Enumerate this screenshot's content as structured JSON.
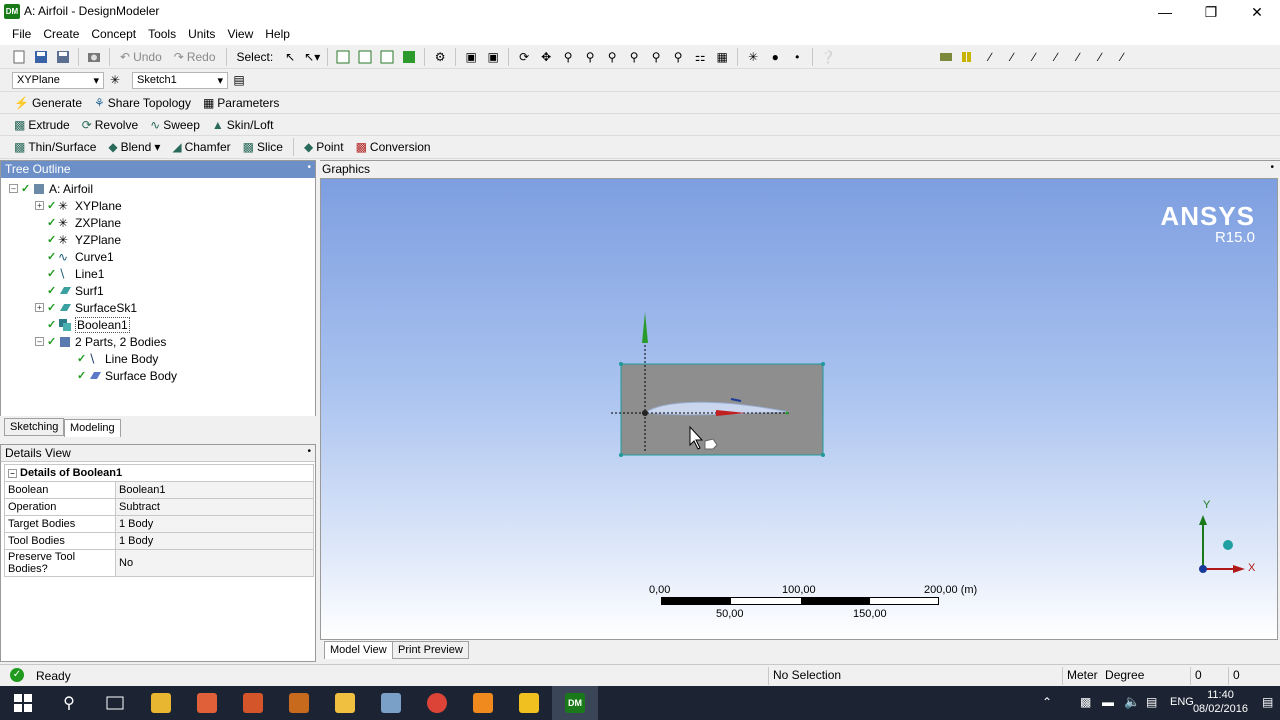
{
  "window": {
    "title": "A: Airfoil - DesignModeler",
    "app_badge": "DM"
  },
  "menu": [
    "File",
    "Create",
    "Concept",
    "Tools",
    "Units",
    "View",
    "Help"
  ],
  "toolbar1": {
    "undo": "Undo",
    "redo": "Redo",
    "select": "Select:"
  },
  "toolbar2": {
    "plane": "XYPlane",
    "sketch": "Sketch1"
  },
  "toolbar3": {
    "generate": "Generate",
    "share_topology": "Share Topology",
    "parameters": "Parameters"
  },
  "toolbar4": {
    "extrude": "Extrude",
    "revolve": "Revolve",
    "sweep": "Sweep",
    "skin_loft": "Skin/Loft"
  },
  "toolbar5": {
    "thin_surface": "Thin/Surface",
    "blend": "Blend",
    "chamfer": "Chamfer",
    "slice": "Slice",
    "point": "Point",
    "conversion": "Conversion"
  },
  "tree": {
    "header": "Tree Outline",
    "items": [
      {
        "label": "A: Airfoil"
      },
      {
        "label": "XYPlane"
      },
      {
        "label": "ZXPlane"
      },
      {
        "label": "YZPlane"
      },
      {
        "label": "Curve1"
      },
      {
        "label": "Line1"
      },
      {
        "label": "Surf1"
      },
      {
        "label": "SurfaceSk1"
      },
      {
        "label": "Boolean1"
      },
      {
        "label": "2 Parts, 2 Bodies"
      },
      {
        "label": "Line Body"
      },
      {
        "label": "Surface Body"
      }
    ],
    "tabs": [
      "Sketching",
      "Modeling"
    ]
  },
  "details": {
    "header": "Details View",
    "section": "Details of Boolean1",
    "rows": [
      {
        "key": "Boolean",
        "value": "Boolean1"
      },
      {
        "key": "Operation",
        "value": "Subtract"
      },
      {
        "key": "Target Bodies",
        "value": "1 Body"
      },
      {
        "key": "Tool Bodies",
        "value": "1 Body"
      },
      {
        "key": "Preserve Tool Bodies?",
        "value": "No"
      }
    ]
  },
  "graphics": {
    "header": "Graphics",
    "logo": "ANSYS",
    "version": "R15.0",
    "scale": {
      "top": [
        "0,00",
        "100,00",
        "200,00 (m)"
      ],
      "bottom": [
        "50,00",
        "150,00"
      ]
    },
    "axes": {
      "x": "X",
      "y": "Y"
    },
    "tabs": [
      "Model View",
      "Print Preview"
    ]
  },
  "status": {
    "ready": "Ready",
    "selection": "No Selection",
    "units_length": "Meter",
    "units_angle": "Degree",
    "v1": "0",
    "v2": "0"
  },
  "taskbar": {
    "lang": "ENG",
    "time": "11:40",
    "date": "08/02/2016"
  },
  "colors": {
    "accent_green": "#1f9a1f",
    "gfx_top": "#7d9ee0",
    "taskbar": "#1c2434"
  }
}
